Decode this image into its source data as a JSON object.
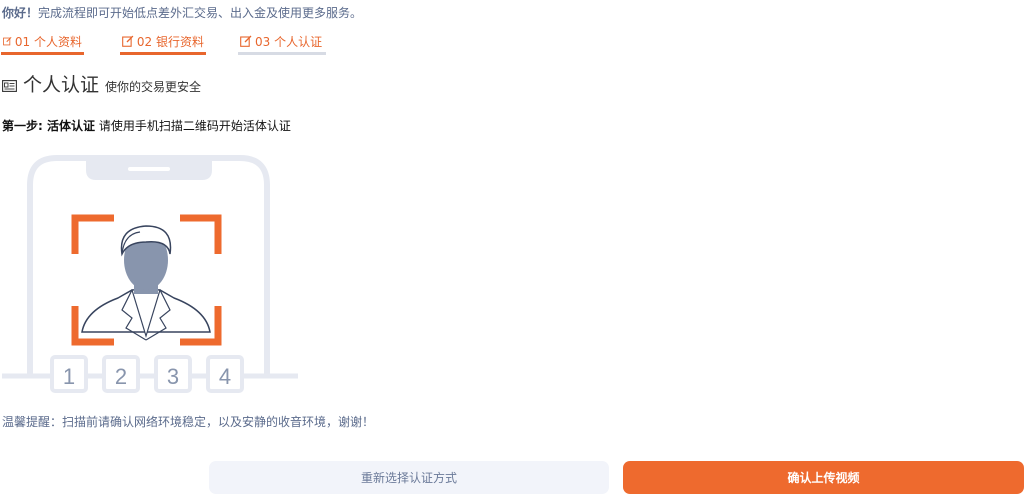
{
  "greeting": {
    "hello": "你好！",
    "message": "完成流程即可开始低点差外汇交易、出入金及使用更多服务。"
  },
  "steps": [
    {
      "label": "01 个人资料",
      "state": "done"
    },
    {
      "label": "02 银行资料",
      "state": "done"
    },
    {
      "label": "03 个人认证",
      "state": "current"
    }
  ],
  "section": {
    "title": "个人认证",
    "subtitle": "使你的交易更安全"
  },
  "instruction": {
    "step_label": "第一步: 活体认证",
    "text": "请使用手机扫描二维码开始活体认证"
  },
  "illustration": {
    "numbers": [
      "1",
      "2",
      "3",
      "4"
    ]
  },
  "tip": "温馨提醒：扫描前请确认网络环境稳定，以及安静的收音环境，谢谢！",
  "buttons": {
    "reselect": "重新选择认证方式",
    "confirm": "确认上传视频"
  },
  "colors": {
    "accent": "#ee6a2e",
    "muted_text": "#5b6b8c",
    "secondary_button_bg": "#f2f4fa"
  }
}
